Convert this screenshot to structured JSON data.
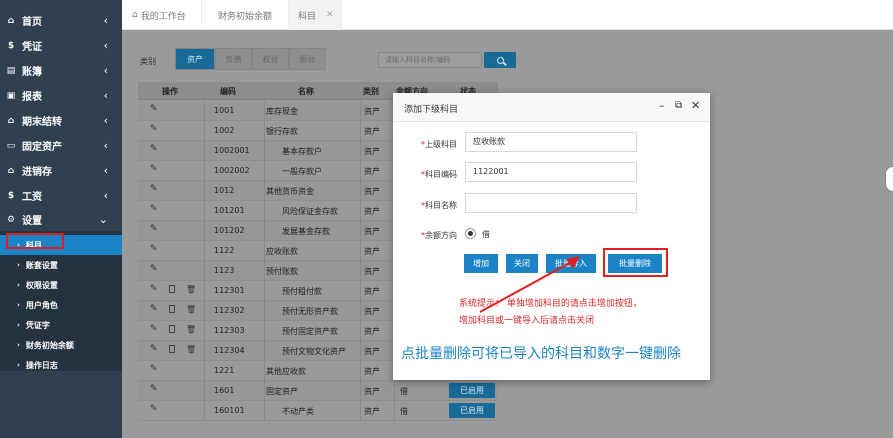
{
  "sidebar": {
    "items": [
      {
        "icon": "home-icon",
        "glyph": "⌂",
        "label": "首页"
      },
      {
        "icon": "dollar-icon",
        "glyph": "$",
        "label": "凭证"
      },
      {
        "icon": "ledger-icon",
        "glyph": "▤",
        "label": "账簿"
      },
      {
        "icon": "report-icon",
        "glyph": "▣",
        "label": "报表"
      },
      {
        "icon": "period-close-icon",
        "glyph": "⌂",
        "label": "期末结转"
      },
      {
        "icon": "monitor-icon",
        "glyph": "▭",
        "label": "固定资产"
      },
      {
        "icon": "inventory-icon",
        "glyph": "⌂",
        "label": "进销存"
      },
      {
        "icon": "salary-icon",
        "glyph": "$",
        "label": "工资"
      },
      {
        "icon": "settings-icon",
        "glyph": "⚙",
        "label": "设置"
      }
    ],
    "sub_items": [
      {
        "label": "科目",
        "active": true
      },
      {
        "label": "账套设置"
      },
      {
        "label": "权限设置"
      },
      {
        "label": "用户角色"
      },
      {
        "label": "凭证字"
      },
      {
        "label": "财务初始余额"
      },
      {
        "label": "操作日志"
      }
    ]
  },
  "tabs": [
    {
      "label": "我的工作台",
      "icon": "home-icon"
    },
    {
      "label": "财务初始余额"
    },
    {
      "label": "科目",
      "closable": true
    }
  ],
  "filter": {
    "label": "类别",
    "tabs": [
      "资产",
      "负债",
      "权益",
      "损益"
    ],
    "search_placeholder": "请输入科目名称/编码"
  },
  "table": {
    "headers": [
      "操作",
      "编码",
      "名称",
      "类别",
      "余额方向",
      "状态"
    ],
    "rows": [
      {
        "code": "1001",
        "name": "库存现金",
        "indent": 0,
        "type": "资产",
        "dir": "",
        "status": "",
        "extra": false
      },
      {
        "code": "1002",
        "name": "银行存款",
        "indent": 0,
        "type": "资产",
        "dir": "",
        "status": "",
        "extra": false
      },
      {
        "code": "1002001",
        "name": "基本存款户",
        "indent": 1,
        "type": "资产",
        "dir": "",
        "status": "",
        "extra": false
      },
      {
        "code": "1002002",
        "name": "一般存款户",
        "indent": 1,
        "type": "资产",
        "dir": "",
        "status": "",
        "extra": false
      },
      {
        "code": "1012",
        "name": "其他货币资金",
        "indent": 0,
        "type": "资产",
        "dir": "",
        "status": "",
        "extra": false
      },
      {
        "code": "101201",
        "name": "风险保证金存款",
        "indent": 1,
        "type": "资产",
        "dir": "",
        "status": "",
        "extra": false
      },
      {
        "code": "101202",
        "name": "发展基金存款",
        "indent": 1,
        "type": "资产",
        "dir": "",
        "status": "",
        "extra": false
      },
      {
        "code": "1122",
        "name": "应收账款",
        "indent": 0,
        "type": "资产",
        "dir": "",
        "status": "",
        "extra": false
      },
      {
        "code": "1123",
        "name": "预付账款",
        "indent": 0,
        "type": "资产",
        "dir": "",
        "status": "",
        "extra": false
      },
      {
        "code": "112301",
        "name": "预付租付款",
        "indent": 1,
        "type": "资产",
        "dir": "",
        "status": "",
        "extra": true
      },
      {
        "code": "112302",
        "name": "预付无形资产款",
        "indent": 1,
        "type": "资产",
        "dir": "",
        "status": "",
        "extra": true
      },
      {
        "code": "112303",
        "name": "预付固定资产款",
        "indent": 1,
        "type": "资产",
        "dir": "",
        "status": "",
        "extra": true
      },
      {
        "code": "112304",
        "name": "预付文物文化资产",
        "indent": 1,
        "type": "资产",
        "dir": "",
        "status": "",
        "extra": true
      },
      {
        "code": "1221",
        "name": "其他应收款",
        "indent": 0,
        "type": "资产",
        "dir": "借",
        "status": "已启用",
        "extra": false
      },
      {
        "code": "1601",
        "name": "固定资产",
        "indent": 0,
        "type": "资产",
        "dir": "借",
        "status": "已启用",
        "extra": false
      },
      {
        "code": "160101",
        "name": "不动产类",
        "indent": 1,
        "type": "资产",
        "dir": "借",
        "status": "已启用",
        "extra": false
      }
    ]
  },
  "dialog": {
    "title": "添加下级科目",
    "fields": {
      "parent_label": "上级科目",
      "parent_value": "应收账款",
      "code_label": "科目编码",
      "code_value": "1122001",
      "name_label": "科目名称",
      "name_value": "",
      "direction_label": "余额方向",
      "direction_value": "借"
    },
    "buttons": {
      "add": "增加",
      "close": "关闭",
      "batch_import": "批量导入",
      "batch_delete": "批量删除"
    },
    "hint_line1": "系统提示： 单独增加科目的请点击增加按钮，",
    "hint_line2": "增加科目或一键导入后请点击关闭",
    "annotation": "点批量删除可将已导入的科目和数字一键删除"
  },
  "colors": {
    "sidebar_bg": "#2f4050",
    "accent": "#1c84c6",
    "highlight_red": "#e02020"
  }
}
